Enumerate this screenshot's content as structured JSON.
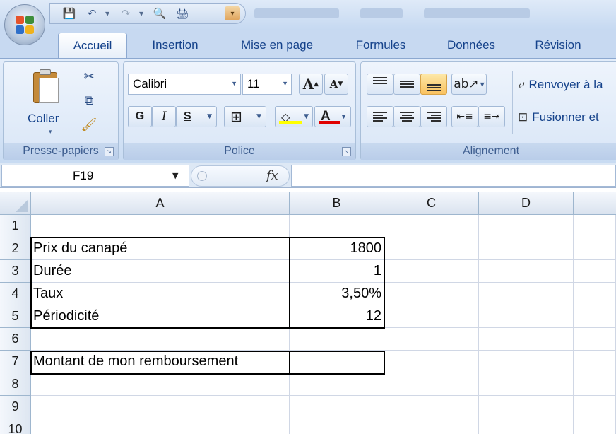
{
  "window": {
    "title": ""
  },
  "qat": {
    "save": "💾",
    "undo": "↶",
    "redo": "↷",
    "print_preview": "🔍",
    "print": "🖨",
    "more": "▾"
  },
  "tabs": [
    "Accueil",
    "Insertion",
    "Mise en page",
    "Formules",
    "Données",
    "Révision"
  ],
  "active_tab": "Accueil",
  "ribbon": {
    "clipboard": {
      "paste_label": "Coller",
      "group_label": "Presse-papiers",
      "paste_arrow": "▾"
    },
    "font": {
      "font_name": "Calibri",
      "font_size": "11",
      "grow": "A",
      "shrink": "A",
      "bold": "G",
      "italic": "I",
      "underline": "S",
      "border_icon": "⊞",
      "fill_icon": "◇",
      "color_icon": "A",
      "group_label": "Police",
      "fill_color": "#ffff00",
      "font_color": "#e00000"
    },
    "alignment": {
      "wrap_text": "Renvoyer à la",
      "merge": "Fusionner et",
      "group_label": "Alignement"
    }
  },
  "formula_bar": {
    "name_box": "F19",
    "fx": "fx",
    "formula": ""
  },
  "sheet": {
    "columns": [
      "A",
      "B",
      "C",
      "D"
    ],
    "rows": [
      "1",
      "2",
      "3",
      "4",
      "5",
      "6",
      "7",
      "8",
      "9",
      "10"
    ],
    "cells": {
      "A2": "Prix du canapé",
      "B2": "1800",
      "A3": "Durée",
      "B3": "1",
      "A4": "Taux",
      "B4": "3,50%",
      "A5": "Périodicité",
      "B5": "12",
      "A7": "Montant de mon remboursement",
      "B7": ""
    }
  }
}
